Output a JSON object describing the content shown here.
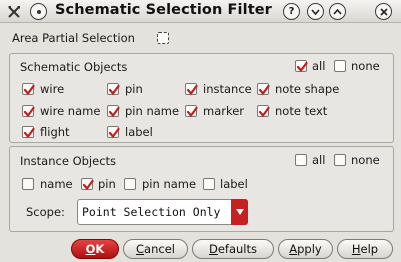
{
  "window": {
    "title": "Schematic Selection Filter",
    "help_icon": "question-icon",
    "minimize_icon": "chevron-down-icon",
    "maximize_icon": "chevron-up-icon",
    "close_icon": "close-icon"
  },
  "area_partial": {
    "label": "Area Partial Selection",
    "checked": false
  },
  "schematic_objects": {
    "title": "Schematic Objects",
    "all": {
      "label": "all",
      "checked": true
    },
    "none": {
      "label": "none",
      "checked": false
    },
    "items": [
      {
        "label": "wire",
        "checked": true
      },
      {
        "label": "pin",
        "checked": true
      },
      {
        "label": "instance",
        "checked": true
      },
      {
        "label": "note shape",
        "checked": true
      },
      {
        "label": "wire name",
        "checked": true
      },
      {
        "label": "pin name",
        "checked": true
      },
      {
        "label": "marker",
        "checked": true
      },
      {
        "label": "note text",
        "checked": true
      },
      {
        "label": "flight",
        "checked": true
      },
      {
        "label": "label",
        "checked": true
      }
    ]
  },
  "instance_objects": {
    "title": "Instance Objects",
    "all": {
      "label": "all",
      "checked": false
    },
    "none": {
      "label": "none",
      "checked": false
    },
    "items": [
      {
        "label": "name",
        "checked": false
      },
      {
        "label": "pin",
        "checked": true
      },
      {
        "label": "pin name",
        "checked": false
      },
      {
        "label": "label",
        "checked": false
      }
    ],
    "scope_label": "Scope:",
    "scope_value": "Point Selection Only"
  },
  "buttons": {
    "ok": {
      "accel": "O",
      "rest": "K"
    },
    "cancel": {
      "accel": "C",
      "rest": "ancel"
    },
    "defaults": {
      "accel": "D",
      "rest": "efaults"
    },
    "apply": {
      "accel": "A",
      "rest": "pply"
    },
    "help": {
      "accel": "H",
      "rest": "elp"
    }
  },
  "colors": {
    "checkmark": "#c21f1f",
    "ok_button": "#c81b1b",
    "combo_arrow": "#c62020"
  }
}
